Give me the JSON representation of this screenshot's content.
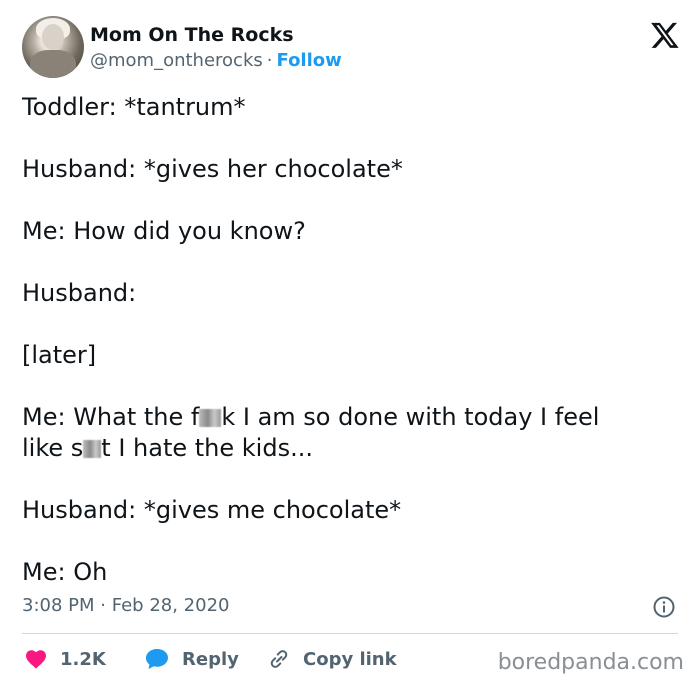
{
  "author": {
    "name": "Mom On The Rocks",
    "handle": "@mom_ontherocks",
    "separator": "·",
    "follow_label": "Follow"
  },
  "tweet": {
    "lines": [
      "Toddler: *tantrum*",
      "Husband: *gives her chocolate*",
      "Me: How did you know?",
      "Husband:",
      "[later]",
      "Me: What the f",
      "k I am so done with today I feel",
      "like s",
      "t I hate the kids...",
      "Husband: *gives me chocolate*",
      "Me: Oh"
    ]
  },
  "meta": {
    "time": "3:08 PM",
    "separator": "·",
    "date": "Feb 28, 2020"
  },
  "actions": {
    "likes": "1.2K",
    "reply_label": "Reply",
    "copy_label": "Copy link"
  },
  "watermark": "boredpanda.com",
  "colors": {
    "link_blue": "#1d9bf0",
    "heart_red": "#f91880",
    "muted_gray": "#536471"
  },
  "icons": [
    "x-logo-icon",
    "info-icon",
    "heart-icon",
    "reply-bubble-icon",
    "link-icon"
  ]
}
